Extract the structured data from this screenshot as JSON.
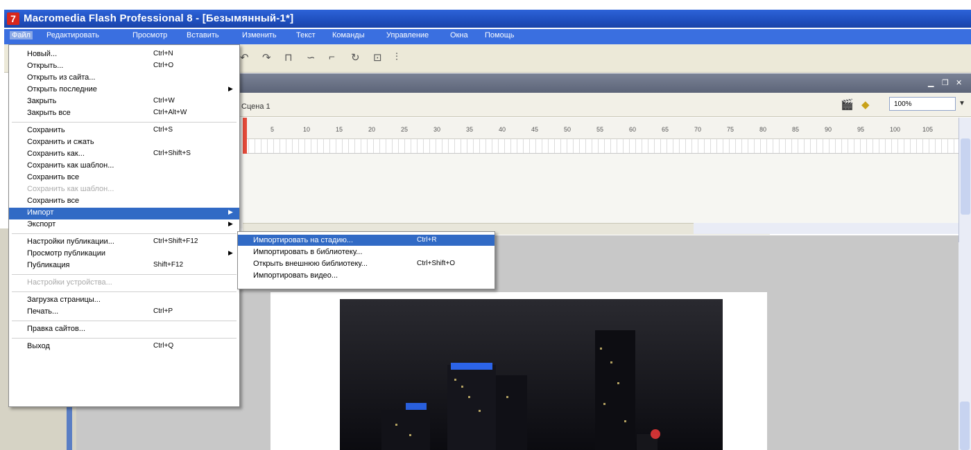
{
  "window": {
    "icon_letter": "7",
    "title": "Macromedia Flash Professional 8 - [Безымянный-1*]"
  },
  "menubar": [
    {
      "label": "Файл",
      "active": true
    },
    {
      "label": "Редактировать"
    },
    {
      "label": "Просмотр"
    },
    {
      "label": "Вставить"
    },
    {
      "label": "Изменить"
    },
    {
      "label": "Текст"
    },
    {
      "label": "Команды"
    },
    {
      "label": "Управление"
    },
    {
      "label": "Окна"
    },
    {
      "label": "Помощь"
    }
  ],
  "toolbar_icons": [
    "undo-icon",
    "redo-icon",
    "snap-icon",
    "smooth-icon",
    "straighten-icon",
    "rotate-icon",
    "scale-icon",
    "align-icon"
  ],
  "timeline": {
    "scene": "Сцена 1",
    "zoom": "100%",
    "frame_ticks": [
      "5",
      "10",
      "15",
      "20",
      "25",
      "30",
      "35",
      "40",
      "45",
      "50",
      "55",
      "60",
      "65",
      "70",
      "75",
      "80",
      "85",
      "90",
      "95",
      "100",
      "105"
    ]
  },
  "file_menu": [
    {
      "label": "Новый...",
      "shortcut": "Ctrl+N"
    },
    {
      "label": "Открыть...",
      "shortcut": "Ctrl+O"
    },
    {
      "label": "Открыть из сайта..."
    },
    {
      "label": "Открыть последние",
      "submenu": true
    },
    {
      "label": "Закрыть",
      "shortcut": "Ctrl+W"
    },
    {
      "label": "Закрыть все",
      "shortcut": "Ctrl+Alt+W"
    },
    {
      "separator": true
    },
    {
      "label": "Сохранить",
      "shortcut": "Ctrl+S"
    },
    {
      "label": "Сохранить и сжать"
    },
    {
      "label": "Сохранить как...",
      "shortcut": "Ctrl+Shift+S"
    },
    {
      "label": "Сохранить как шаблон..."
    },
    {
      "label": "Сохранить все"
    },
    {
      "label": "Сохранить как шаблон...",
      "disabled": true
    },
    {
      "label": "Сохранить все"
    },
    {
      "label": "Импорт",
      "submenu": true,
      "highlighted": true
    },
    {
      "label": "Экспорт",
      "submenu": true
    },
    {
      "separator": true
    },
    {
      "label": "Настройки публикации...",
      "shortcut": "Ctrl+Shift+F12"
    },
    {
      "label": "Просмотр публикации",
      "submenu": true
    },
    {
      "label": "Публикация",
      "shortcut": "Shift+F12"
    },
    {
      "separator": true
    },
    {
      "label": "Настройки устройства...",
      "disabled": true
    },
    {
      "separator": true
    },
    {
      "label": "Загрузка страницы..."
    },
    {
      "label": "Печать...",
      "shortcut": "Ctrl+P"
    },
    {
      "separator": true
    },
    {
      "label": "Правка сайтов..."
    },
    {
      "separator": true
    },
    {
      "label": "Выход",
      "shortcut": "Ctrl+Q"
    }
  ],
  "import_submenu": [
    {
      "label": "Импортировать на стадию...",
      "shortcut": "Ctrl+R",
      "highlighted": true
    },
    {
      "label": "Импортировать в библиотеку..."
    },
    {
      "label": "Открыть внешнюю библиотеку...",
      "shortcut": "Ctrl+Shift+O"
    },
    {
      "label": "Импортировать видео..."
    }
  ],
  "colors": {
    "titlebar": "#1f4fbe",
    "menubar": "#3a6fe0",
    "highlight": "#316ac5",
    "playhead": "#e34a3a"
  }
}
